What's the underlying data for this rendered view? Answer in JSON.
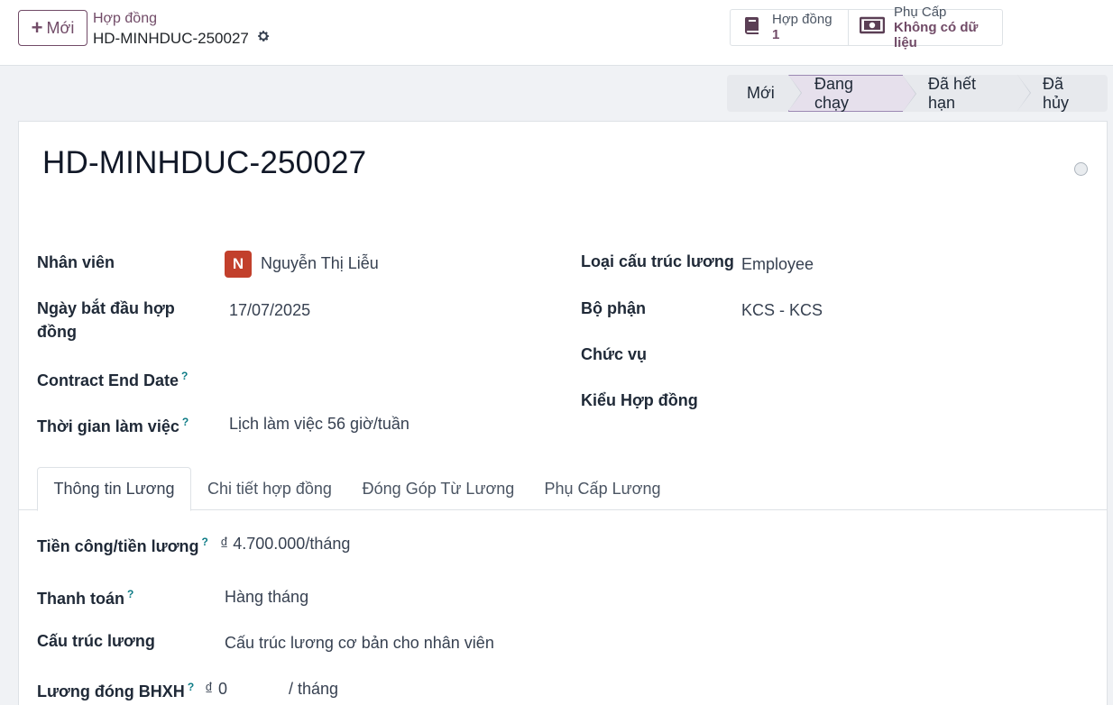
{
  "control_panel": {
    "new_button": "Mới",
    "breadcrumb_parent": "Hợp đồng",
    "breadcrumb_current": "HD-MINHDUC-250027",
    "smart_buttons": [
      {
        "title": "Hợp đồng",
        "value": "1",
        "icon": "book-icon"
      },
      {
        "title": "Phụ Cấp",
        "value": "Không có dữ liệu",
        "icon": "money-icon"
      }
    ]
  },
  "statusbar": {
    "stages": [
      "Mới",
      "Đang chạy",
      "Đã hết hạn",
      "Đã hủy"
    ],
    "active": "Đang chạy"
  },
  "record": {
    "title": "HD-MINHDUC-250027",
    "left_fields": {
      "employee_label": "Nhân viên",
      "employee_initial": "N",
      "employee_value": "Nguyễn Thị Liễu",
      "start_label_line1": "Ngày bắt đầu hợp",
      "start_label_line2": "đồng",
      "start_value": "17/07/2025",
      "end_label": "Contract End Date",
      "schedule_label": "Thời gian làm việc",
      "schedule_value": "Lịch làm việc 56 giờ/tuần"
    },
    "right_fields": {
      "structure_type_label": "Loại cấu trúc lương",
      "structure_type_value": "Employee",
      "department_label": "Bộ phận",
      "department_value": "KCS - KCS",
      "job_label": "Chức vụ",
      "contract_type_label": "Kiểu Hợp đồng"
    },
    "help_marker": "?"
  },
  "tabs": [
    "Thông tin Lương",
    "Chi tiết hợp đồng",
    "Đóng Góp Từ Lương",
    "Phụ Cấp Lương"
  ],
  "salary": {
    "wage_label": "Tiền công/tiền lương",
    "wage_value": "₫ 4.700.000/tháng",
    "payment_label": "Thanh toán",
    "payment_value": "Hàng tháng",
    "structure_label": "Cấu trúc lương",
    "structure_value": "Cấu trúc lương cơ bản cho nhân viên",
    "insurance_label": "Lương đóng BHXH",
    "insurance_currency": "₫",
    "insurance_value": "0",
    "insurance_unit": "/ tháng"
  }
}
